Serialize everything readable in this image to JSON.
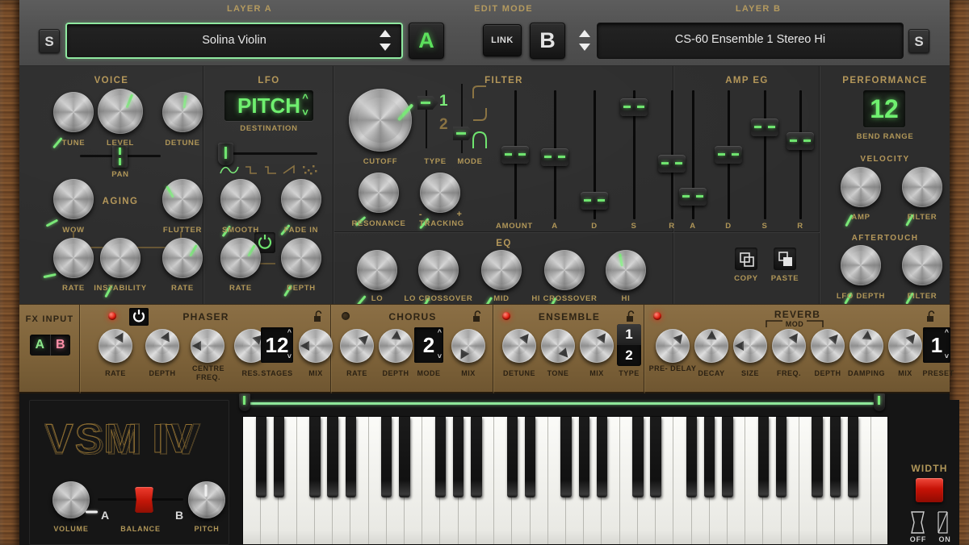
{
  "header": {
    "layer_a_title": "LAYER A",
    "edit_mode_title": "EDIT MODE",
    "layer_b_title": "LAYER B",
    "solo_a": "S",
    "solo_b": "S",
    "patch_a": "Solina Violin",
    "patch_b": "CS-60 Ensemble 1 Stereo Hi",
    "btn_a": "A",
    "btn_b": "B",
    "link": "LINK",
    "accent_green": "#7ae878",
    "accent_gold": "#b4975a"
  },
  "voice": {
    "title": "VOICE",
    "aging_title": "AGING",
    "knobs": [
      {
        "label": "TUNE",
        "angle": -140
      },
      {
        "label": "LEVEL",
        "angle": 22
      },
      {
        "label": "DETUNE",
        "angle": 8
      },
      {
        "label": "WOW",
        "angle": -118
      },
      {
        "label": "FLUTTER",
        "angle": -30
      },
      {
        "label": "RATE",
        "angle": -102
      },
      {
        "label": "INSTABILITY",
        "angle": -152
      },
      {
        "label": "RATE",
        "angle": 30
      }
    ],
    "pan_label": "PAN"
  },
  "lfo": {
    "title": "LFO",
    "destination_value": "PITCH",
    "destination_label": "DESTINATION",
    "waveforms": [
      "sine",
      "square",
      "pulse",
      "ramp",
      "random"
    ],
    "selected_waveform": 0,
    "sync_icon": "sync-icon",
    "knobs": [
      {
        "label": "SMOOTH",
        "angle": -145
      },
      {
        "label": "FADE IN",
        "angle": -140
      },
      {
        "label": "RATE",
        "angle": 30
      },
      {
        "label": "DEPTH",
        "angle": -148
      }
    ]
  },
  "filter": {
    "title": "FILTER",
    "cutoff_label": "CUTOFF",
    "cutoff_angle": 42,
    "resonance_label": "RESONANCE",
    "resonance_angle": -132,
    "tracking_label": "TRACKING",
    "tracking_angle": -140,
    "tracking_minus": "-",
    "tracking_plus": "+",
    "type_label": "TYPE",
    "type_options": [
      "1",
      "2"
    ],
    "type_selected": "1",
    "mode_label": "MODE",
    "mode_options": [
      "lowpass",
      "highpass",
      "bandpass"
    ],
    "mode_selected": 2,
    "sliders": [
      {
        "label": "AMOUNT",
        "value": 50
      },
      {
        "label": "A",
        "value": 48
      },
      {
        "label": "D",
        "value": 9
      },
      {
        "label": "S",
        "value": 93
      },
      {
        "label": "R",
        "value": 42
      }
    ]
  },
  "eq": {
    "title": "EQ",
    "knobs": [
      {
        "label": "LO",
        "angle": -140
      },
      {
        "label": "LO CROSSOVER",
        "angle": -150
      },
      {
        "label": "MID",
        "angle": -148
      },
      {
        "label": "HI CROSSOVER",
        "angle": -152
      },
      {
        "label": "HI",
        "angle": -10
      }
    ]
  },
  "amp_eg": {
    "title": "AMP EG",
    "sliders": [
      {
        "label": "A",
        "value": 12
      },
      {
        "label": "D",
        "value": 50
      },
      {
        "label": "S",
        "value": 75
      },
      {
        "label": "R",
        "value": 62
      }
    ],
    "copy_label": "COPY",
    "paste_label": "PASTE",
    "copy_icon": "copy-icon",
    "paste_icon": "paste-icon"
  },
  "performance": {
    "title": "PERFORMANCE",
    "bend_range_value": "12",
    "bend_range_label": "BEND RANGE",
    "velocity_title": "VELOCITY",
    "aftertouch_title": "AFTERTOUCH",
    "knobs": [
      {
        "label": "AMP",
        "angle": -152
      },
      {
        "label": "FILTER",
        "angle": -150
      },
      {
        "label": "LFO DEPTH",
        "angle": -150
      },
      {
        "label": "FILTER",
        "angle": -150
      }
    ]
  },
  "fx": {
    "input_title": "FX INPUT",
    "input_a": "A",
    "input_b": "B",
    "input_a_color": "#8ce88c",
    "input_b_color": "#ff8fa8",
    "panels": [
      {
        "name": "PHASER",
        "led": "on",
        "sync_icon": "sync-icon",
        "lock_icon": "lock-open-icon",
        "controls": [
          {
            "label": "RATE",
            "type": "knob",
            "angle": 30
          },
          {
            "label": "DEPTH",
            "type": "knob",
            "angle": 25
          },
          {
            "label": "CENTRE FREQ.",
            "type": "knob",
            "angle": -90
          },
          {
            "label": "RES.",
            "type": "knob",
            "angle": 45
          },
          {
            "label": "STAGES",
            "type": "number",
            "value": "12"
          },
          {
            "label": "MIX",
            "type": "knob",
            "angle": -90
          }
        ]
      },
      {
        "name": "CHORUS",
        "led": "off",
        "lock_icon": "lock-open-icon",
        "controls": [
          {
            "label": "RATE",
            "type": "knob",
            "angle": 47
          },
          {
            "label": "DEPTH",
            "type": "knob",
            "angle": 5
          },
          {
            "label": "MODE",
            "type": "number",
            "value": "2"
          },
          {
            "label": "MIX",
            "type": "knob",
            "angle": 210
          }
        ]
      },
      {
        "name": "ENSEMBLE",
        "led": "on",
        "lock_icon": "lock-open-icon",
        "controls": [
          {
            "label": "DETUNE",
            "type": "knob",
            "angle": 38
          },
          {
            "label": "TONE",
            "type": "knob",
            "angle": 140
          },
          {
            "label": "MIX",
            "type": "knob",
            "angle": 35
          },
          {
            "label": "TYPE",
            "type": "twoway",
            "options": [
              "1",
              "2"
            ],
            "selected": "1"
          }
        ]
      },
      {
        "name": "REVERB",
        "led": "on",
        "mod_label": "MOD",
        "lock_icon": "lock-open-icon",
        "controls": [
          {
            "label": "PRE- DELAY",
            "type": "knob",
            "angle": 40
          },
          {
            "label": "DECAY",
            "type": "knob",
            "angle": 2
          },
          {
            "label": "SIZE",
            "type": "knob",
            "angle": -90
          },
          {
            "label": "FREQ.",
            "type": "knob",
            "angle": 35
          },
          {
            "label": "DEPTH",
            "type": "knob",
            "angle": 42
          },
          {
            "label": "DAMPING",
            "type": "knob",
            "angle": 5
          },
          {
            "label": "MIX",
            "type": "knob",
            "angle": 40
          },
          {
            "label": "PRESET",
            "type": "number",
            "value": "1"
          }
        ]
      }
    ]
  },
  "bottom": {
    "logo": "VSM IV",
    "volume_label": "VOLUME",
    "volume_angle": 90,
    "balance_label": "BALANCE",
    "balance_a": "A",
    "balance_b": "B",
    "pitch_label": "PITCH",
    "pitch_angle": 0,
    "width_label": "WIDTH",
    "width_off": "OFF",
    "width_on": "ON",
    "width_state": "on"
  }
}
